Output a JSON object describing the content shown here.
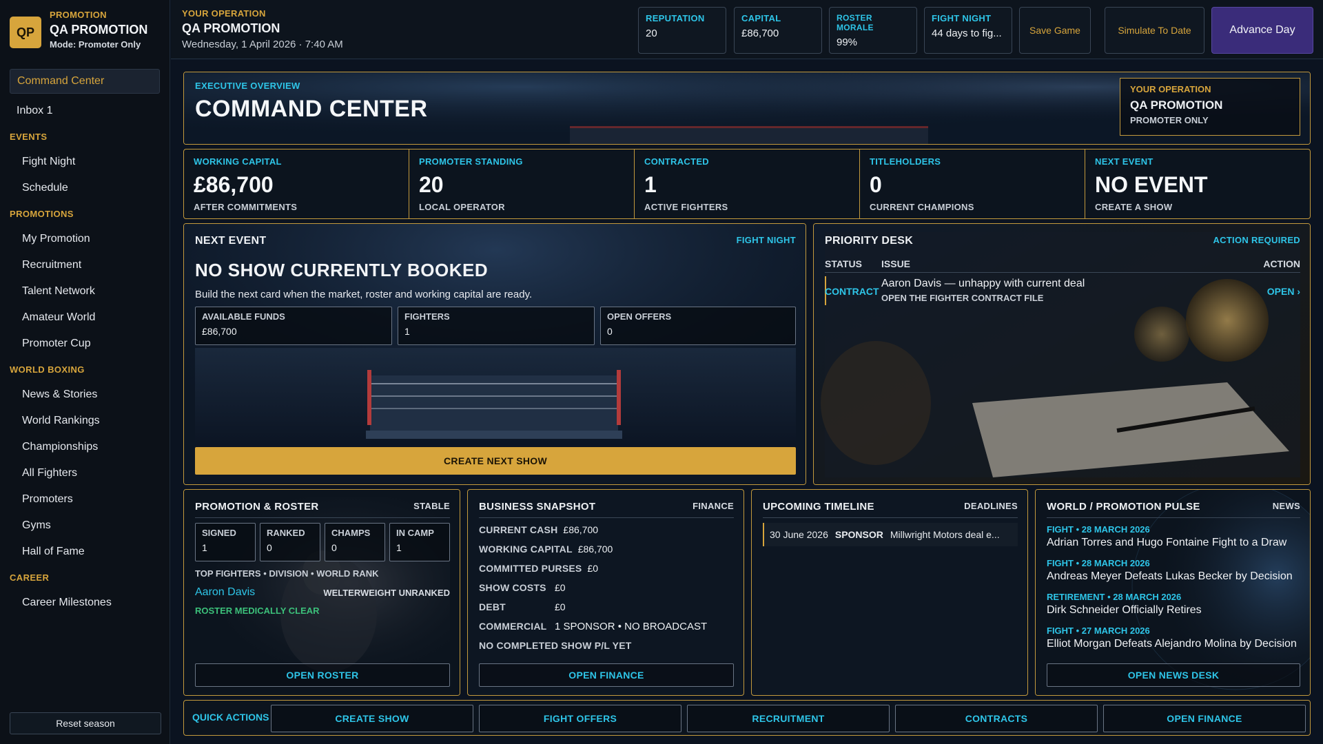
{
  "brand": {
    "badge": "QP",
    "kicker": "PROMOTION",
    "name": "QA PROMOTION",
    "mode": "Mode: Promoter Only"
  },
  "sidebar": {
    "active": "Command Center",
    "inbox": "Inbox 1",
    "sections": [
      {
        "title": "EVENTS",
        "items": [
          "Fight Night",
          "Schedule"
        ]
      },
      {
        "title": "PROMOTIONS",
        "items": [
          "My Promotion",
          "Recruitment",
          "Talent Network",
          "Amateur World",
          "Promoter Cup"
        ]
      },
      {
        "title": "WORLD BOXING",
        "items": [
          "News & Stories",
          "World Rankings",
          "Championships",
          "All Fighters",
          "Promoters",
          "Gyms",
          "Hall of Fame"
        ]
      },
      {
        "title": "CAREER",
        "items": [
          "Career Milestones"
        ]
      }
    ],
    "reset": "Reset season"
  },
  "topbar": {
    "kicker": "YOUR OPERATION",
    "name": "QA PROMOTION",
    "date": "Wednesday, 1 April 2026 · 7:40 AM",
    "stats": [
      {
        "label": "REPUTATION",
        "value": "20"
      },
      {
        "label": "CAPITAL",
        "value": "£86,700"
      },
      {
        "label": "ROSTER MORALE",
        "value": "99%"
      },
      {
        "label": "FIGHT NIGHT",
        "value": "44 days to fig..."
      }
    ],
    "save": "Save Game",
    "simulate": "Simulate To Date",
    "advance": "Advance Day"
  },
  "hero": {
    "kicker": "EXECUTIVE OVERVIEW",
    "title": "COMMAND CENTER",
    "op_kicker": "YOUR OPERATION",
    "op_name": "QA PROMOTION",
    "op_mode": "PROMOTER ONLY"
  },
  "kpis": [
    {
      "label": "WORKING CAPITAL",
      "value": "£86,700",
      "sub": "AFTER COMMITMENTS"
    },
    {
      "label": "PROMOTER STANDING",
      "value": "20",
      "sub": "LOCAL OPERATOR"
    },
    {
      "label": "CONTRACTED",
      "value": "1",
      "sub": "ACTIVE FIGHTERS"
    },
    {
      "label": "TITLEHOLDERS",
      "value": "0",
      "sub": "CURRENT CHAMPIONS"
    },
    {
      "label": "NEXT EVENT",
      "value": "NO EVENT",
      "sub": "CREATE A SHOW"
    }
  ],
  "next_event": {
    "title": "NEXT EVENT",
    "tag": "FIGHT NIGHT",
    "headline": "NO SHOW CURRENTLY BOOKED",
    "desc": "Build the next card when the market, roster and working capital are ready.",
    "boxes": [
      {
        "label": "AVAILABLE FUNDS",
        "value": "£86,700"
      },
      {
        "label": "FIGHTERS",
        "value": "1"
      },
      {
        "label": "OPEN OFFERS",
        "value": "0"
      }
    ],
    "button": "CREATE NEXT SHOW"
  },
  "priority": {
    "title": "PRIORITY DESK",
    "tag": "ACTION REQUIRED",
    "col_status": "STATUS",
    "col_issue": "ISSUE",
    "col_action": "ACTION",
    "row_status": "CONTRACT",
    "row_issue": "Aaron Davis — unhappy with current deal",
    "row_sub": "OPEN THE FIGHTER CONTRACT FILE",
    "row_action": "OPEN ›"
  },
  "roster": {
    "title": "PROMOTION & ROSTER",
    "tag": "STABLE",
    "boxes": [
      {
        "label": "SIGNED",
        "value": "1"
      },
      {
        "label": "RANKED",
        "value": "0"
      },
      {
        "label": "CHAMPS",
        "value": "0"
      },
      {
        "label": "IN CAMP",
        "value": "1"
      }
    ],
    "header": "TOP FIGHTERS • DIVISION • WORLD RANK",
    "fighter_name": "Aaron Davis",
    "fighter_meta": "WELTERWEIGHT UNRANKED",
    "medical": "ROSTER MEDICALLY CLEAR",
    "button": "OPEN ROSTER"
  },
  "business": {
    "title": "BUSINESS SNAPSHOT",
    "tag": "FINANCE",
    "rows": [
      {
        "label": "CURRENT CASH",
        "value": "£86,700"
      },
      {
        "label": "WORKING CAPITAL",
        "value": "£86,700"
      },
      {
        "label": "COMMITTED PURSES",
        "value": "£0"
      },
      {
        "label": "SHOW COSTS",
        "value": "£0"
      },
      {
        "label": "DEBT",
        "value": "£0"
      }
    ],
    "commercial_label": "COMMERCIAL",
    "commercial_value": "1 SPONSOR • NO BROADCAST",
    "pl_note": "NO COMPLETED SHOW P/L YET",
    "button": "OPEN FINANCE"
  },
  "timeline": {
    "title": "UPCOMING TIMELINE",
    "tag": "DEADLINES",
    "items": [
      {
        "date": "30 June 2026",
        "type": "SPONSOR",
        "text": "Millwright Motors deal e..."
      }
    ]
  },
  "pulse": {
    "title": "WORLD / PROMOTION PULSE",
    "tag": "NEWS",
    "items": [
      {
        "meta": "FIGHT • 28 MARCH 2026",
        "head": "Adrian Torres and Hugo Fontaine Fight to a Draw"
      },
      {
        "meta": "FIGHT • 28 MARCH 2026",
        "head": "Andreas Meyer Defeats Lukas Becker by Decision"
      },
      {
        "meta": "RETIREMENT • 28 MARCH 2026",
        "head": "Dirk Schneider Officially Retires"
      },
      {
        "meta": "FIGHT • 27 MARCH 2026",
        "head": "Elliot Morgan Defeats Alejandro Molina by Decision"
      }
    ],
    "button": "OPEN NEWS DESK"
  },
  "quick_actions": {
    "label": "QUICK ACTIONS",
    "buttons": [
      "CREATE SHOW",
      "FIGHT OFFERS",
      "RECRUITMENT",
      "CONTRACTS",
      "OPEN FINANCE"
    ]
  },
  "colors": {
    "gold": "#d7a53c",
    "cyan": "#2ec5e8",
    "green": "#3cc07a",
    "advance": "#3a2c7a"
  }
}
